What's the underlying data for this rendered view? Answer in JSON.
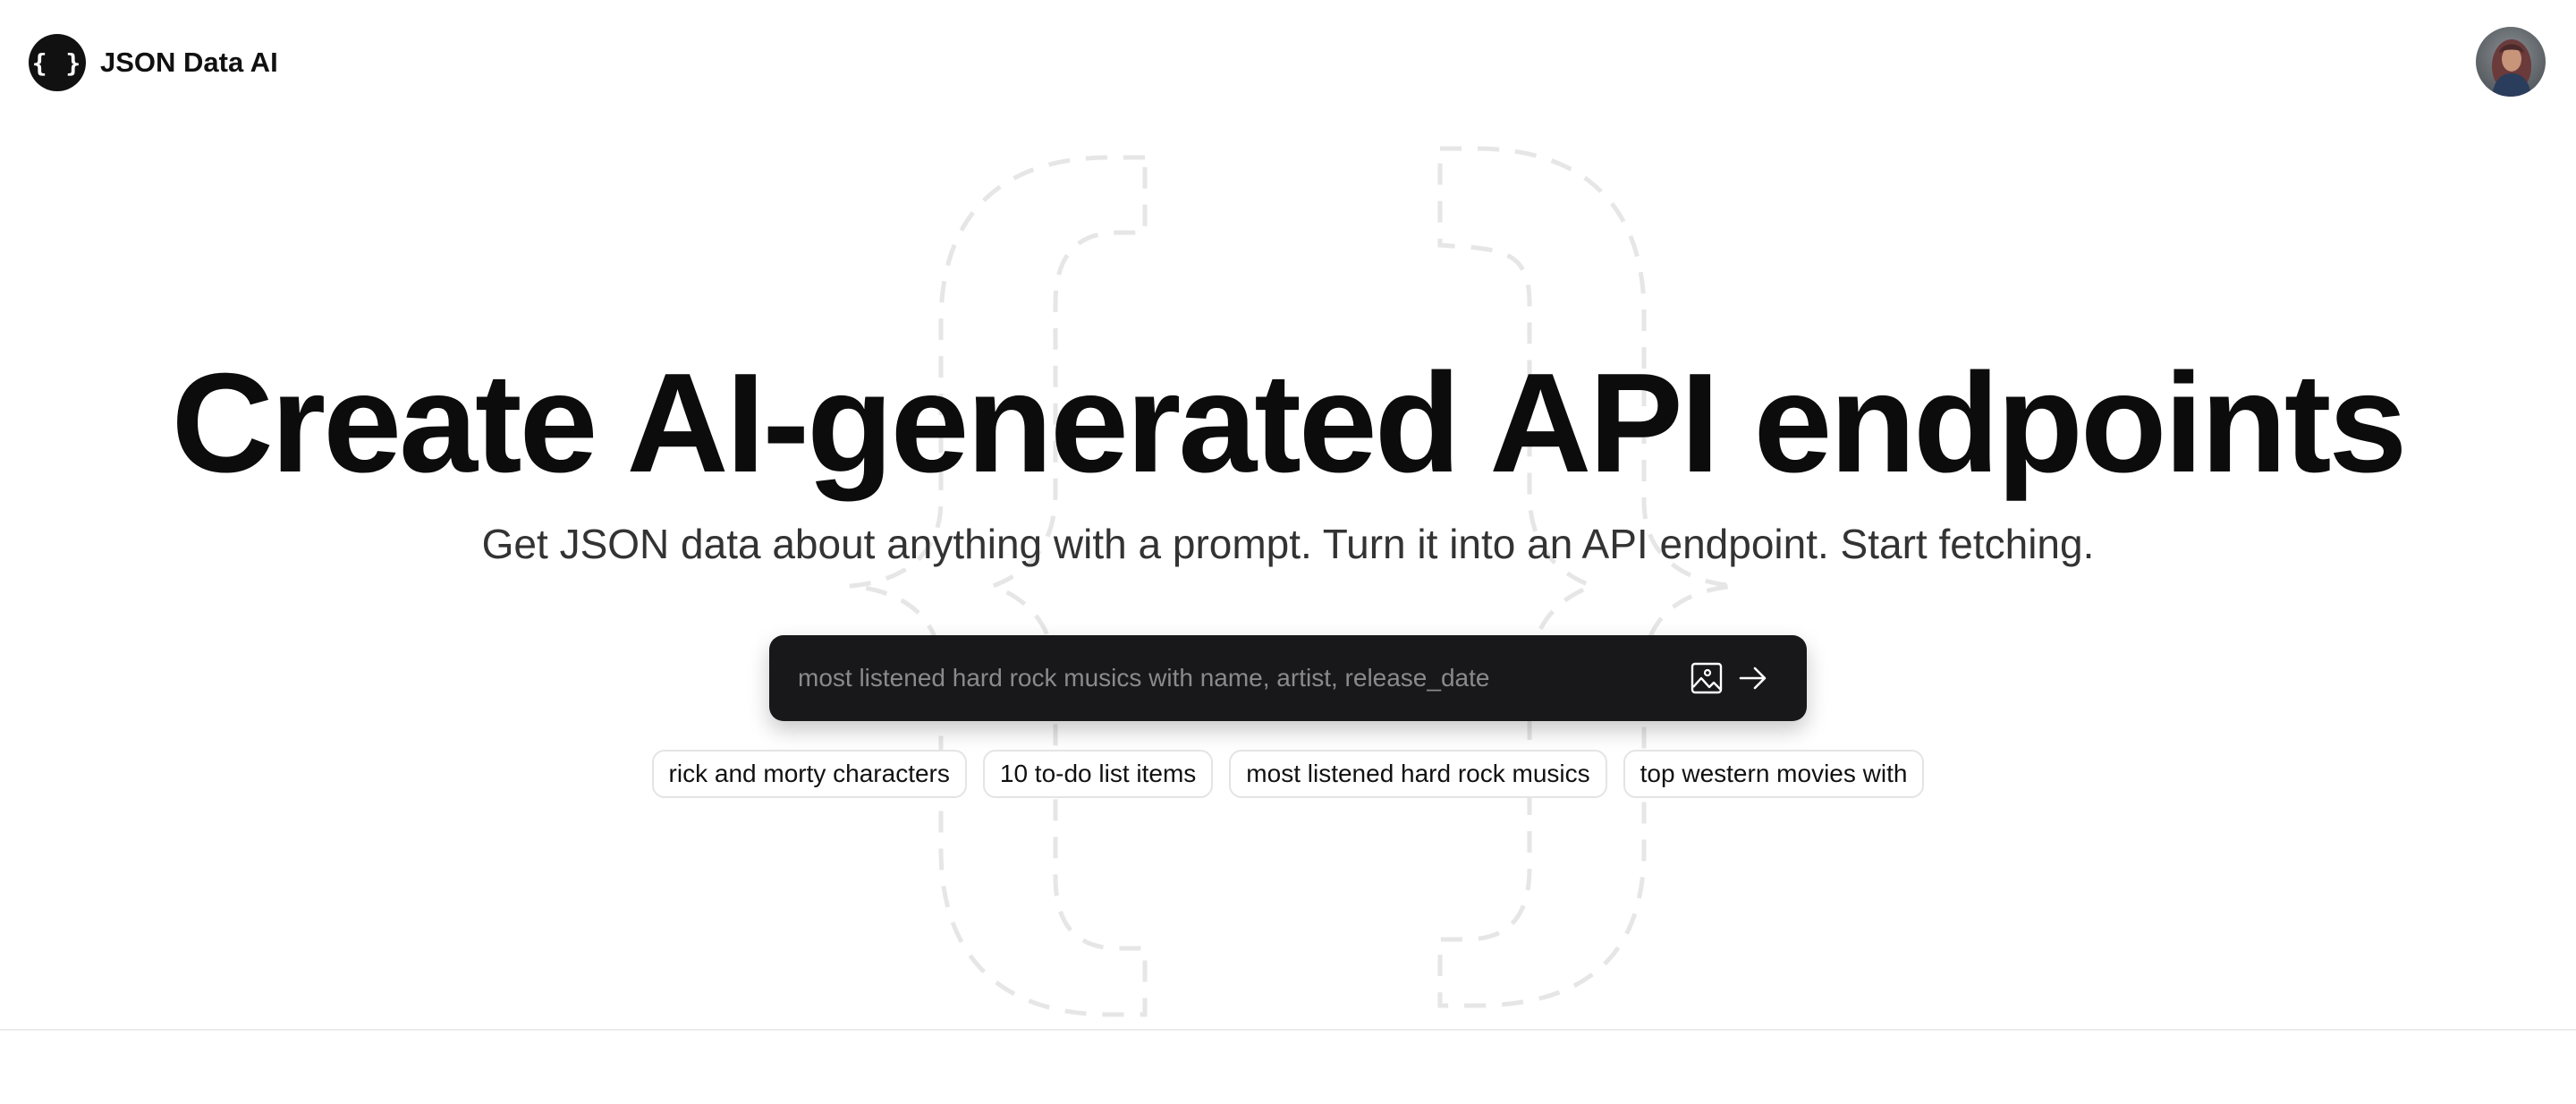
{
  "header": {
    "logo_glyph": "{ }",
    "brand_name": "JSON Data AI",
    "avatar_icon": "user-avatar"
  },
  "hero": {
    "title": "Create AI-generated API endpoints",
    "subtitle": "Get JSON data about anything with a prompt. Turn it into an API endpoint. Start fetching."
  },
  "search": {
    "placeholder": "most listened hard rock musics with name, artist, release_date",
    "value": "",
    "image_icon": "image-icon",
    "submit_icon": "arrow-right-icon"
  },
  "suggestions": [
    "rick and morty characters",
    "10 to-do list items",
    "most listened hard rock musics",
    "top western movies with"
  ],
  "colors": {
    "background": "#ffffff",
    "search_bg": "#18181a",
    "text_primary": "#0c0c0c",
    "chip_border": "#e4e4e4",
    "decoration": "#e6e6e6"
  }
}
